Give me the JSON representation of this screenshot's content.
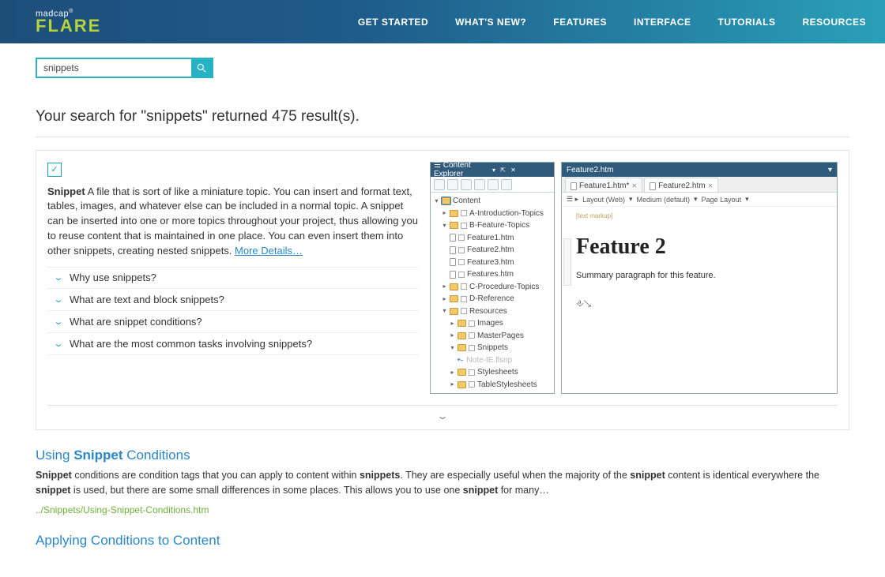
{
  "brand": {
    "top": "madcap",
    "reg": "®",
    "bottom": "FLARE"
  },
  "nav": [
    "GET STARTED",
    "WHAT'S NEW?",
    "FEATURES",
    "INTERFACE",
    "TUTORIALS",
    "RESOURCES"
  ],
  "search": {
    "value": "snippets"
  },
  "results_heading": "Your search for \"snippets\" returned 475 result(s).",
  "snippet_def": {
    "term": "Snippet",
    "text": " A file that is sort of like a miniature topic. You can insert and format text, tables, images, and whatever else can be included in a normal topic. A snippet can be inserted into one or more topics throughout your project, thus allowing you to reuse content that is maintained in one place. You can even insert them into other snippets, creating nested snippets. ",
    "more": "More Details…"
  },
  "accordion": [
    "Why use snippets?",
    "What are text and block snippets?",
    "What are snippet conditions?",
    "What are the most common tasks involving snippets?"
  ],
  "cexp": {
    "title": "Content Explorer",
    "root": "Content",
    "items": [
      "A-Introduction-Topics",
      "B-Feature-Topics",
      "Feature1.htm",
      "Feature2.htm",
      "Feature3.htm",
      "Features.htm",
      "C-Procedure-Topics",
      "D-Reference",
      "Resources",
      "Images",
      "MasterPages",
      "Snippets",
      "Note-IE.flsnp",
      "Stylesheets",
      "TableStylesheets"
    ]
  },
  "editor": {
    "win_title": "Feature2.htm",
    "tabs": [
      "Feature1.htm*",
      "Feature2.htm"
    ],
    "opts": [
      "Layout (Web)",
      "Medium (default)",
      "Page Layout"
    ],
    "markup": "[text markup]",
    "h2": "Feature 2",
    "para": "Summary paragraph for this feature."
  },
  "result2": {
    "title_pre": "Using ",
    "title_kw": "Snippet",
    "title_post": " Conditions",
    "body_parts": [
      "Snippet",
      " conditions are condition tags that you can apply to content within ",
      "snippets",
      ". They are especially useful when the majority of the ",
      "snippet",
      " content is identical everywhere the ",
      "snippet",
      " is used, but there are some small differences in some places. This allows you to use one ",
      "snippet",
      " for many…"
    ],
    "path": "../Snippets/Using-Snippet-Conditions.htm"
  },
  "result3": {
    "title": "Applying Conditions to Content"
  }
}
